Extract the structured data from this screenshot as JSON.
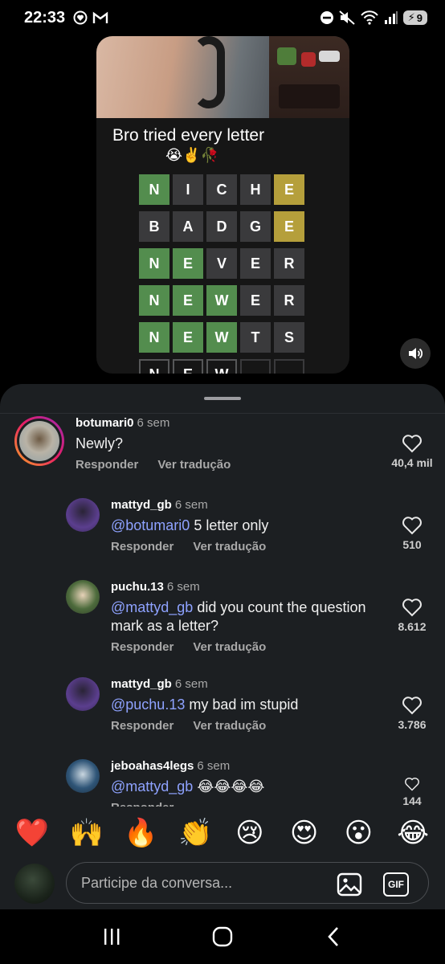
{
  "status_bar": {
    "time": "22:33",
    "battery": "9",
    "icons_left": [
      "heart-circle-icon",
      "gmail-icon"
    ],
    "icons_right": [
      "do-not-disturb-icon",
      "mute-icon",
      "wifi-icon",
      "signal-icon",
      "battery-icon"
    ]
  },
  "video": {
    "caption": "Bro tried every letter",
    "caption_emoji": "😭✌️🥀",
    "board": [
      [
        {
          "l": "N",
          "s": "green"
        },
        {
          "l": "I",
          "s": "gray"
        },
        {
          "l": "C",
          "s": "gray"
        },
        {
          "l": "H",
          "s": "gray"
        },
        {
          "l": "E",
          "s": "yellow"
        }
      ],
      [
        {
          "l": "B",
          "s": "gray"
        },
        {
          "l": "A",
          "s": "gray"
        },
        {
          "l": "D",
          "s": "gray"
        },
        {
          "l": "G",
          "s": "gray"
        },
        {
          "l": "E",
          "s": "yellow"
        }
      ],
      [
        {
          "l": "N",
          "s": "green"
        },
        {
          "l": "E",
          "s": "green"
        },
        {
          "l": "V",
          "s": "gray"
        },
        {
          "l": "E",
          "s": "gray"
        },
        {
          "l": "R",
          "s": "gray"
        }
      ],
      [
        {
          "l": "N",
          "s": "green"
        },
        {
          "l": "E",
          "s": "green"
        },
        {
          "l": "W",
          "s": "green"
        },
        {
          "l": "E",
          "s": "gray"
        },
        {
          "l": "R",
          "s": "gray"
        }
      ],
      [
        {
          "l": "N",
          "s": "green"
        },
        {
          "l": "E",
          "s": "green"
        },
        {
          "l": "W",
          "s": "green"
        },
        {
          "l": "T",
          "s": "gray"
        },
        {
          "l": "S",
          "s": "gray"
        }
      ],
      [
        {
          "l": "N",
          "s": "typed"
        },
        {
          "l": "E",
          "s": "typed"
        },
        {
          "l": "W",
          "s": "typed"
        },
        {
          "l": "",
          "s": "empty"
        },
        {
          "l": "",
          "s": "empty"
        }
      ]
    ]
  },
  "comments": [
    {
      "username": "botumari0",
      "time": "6 sem",
      "mention": "",
      "text": "Newly?",
      "reply_label": "Responder",
      "translate_label": "Ver tradução",
      "likes": "40,4 mil"
    },
    {
      "username": "mattyd_gb",
      "time": "6 sem",
      "mention": "@botumari0",
      "text": " 5 letter only",
      "reply_label": "Responder",
      "translate_label": "Ver tradução",
      "likes": "510"
    },
    {
      "username": "puchu.13",
      "time": "6 sem",
      "mention": "@mattyd_gb",
      "text": " did you count the question mark as a letter?",
      "reply_label": "Responder",
      "translate_label": "Ver tradução",
      "likes": "8.612"
    },
    {
      "username": "mattyd_gb",
      "time": "6 sem",
      "mention": "@puchu.13",
      "text": " my bad im stupid",
      "reply_label": "Responder",
      "translate_label": "Ver tradução",
      "likes": "3.786"
    },
    {
      "username": "jeboahas4legs",
      "time": "6 sem",
      "mention": "@mattyd_gb",
      "text": " 😂😂😂😂",
      "reply_label": "Responder",
      "translate_label": "",
      "likes": "144"
    }
  ],
  "reactions": [
    "❤️",
    "🙌",
    "🔥",
    "👏",
    "😢",
    "😍",
    "😮",
    "😂"
  ],
  "input": {
    "placeholder": "Participe da conversa...",
    "gif_label": "GIF"
  },
  "colors": {
    "sheet_bg": "#1c1f22",
    "mention": "#8ea2ff",
    "wordle_green": "#538d4e",
    "wordle_yellow": "#b59f3b",
    "wordle_gray": "#3a3a3c"
  }
}
